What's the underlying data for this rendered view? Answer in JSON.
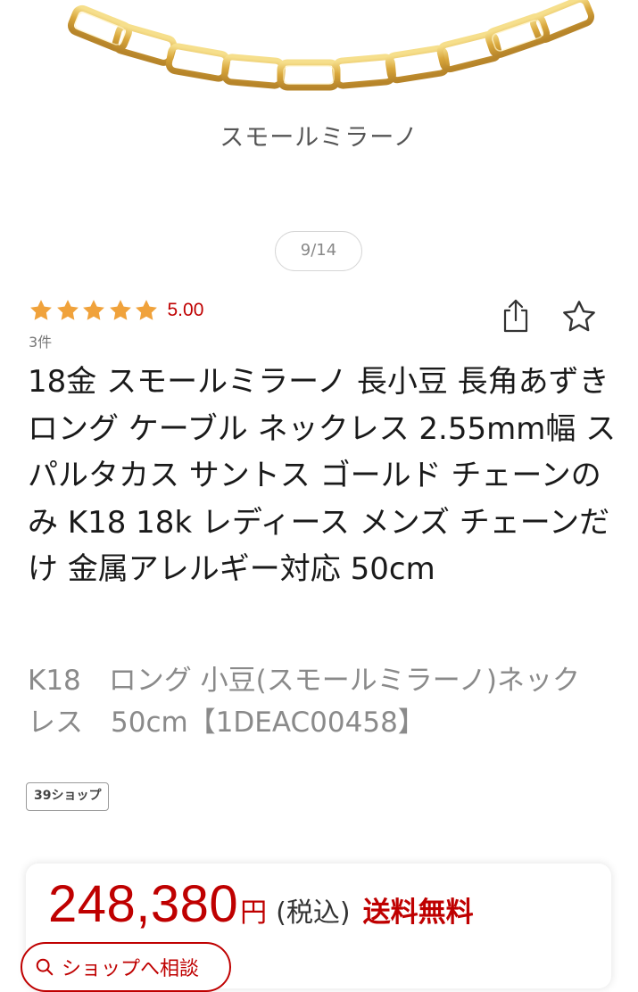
{
  "hero": {
    "caption": "スモールミラーノ",
    "pager": "9/14"
  },
  "rating": {
    "stars": 5,
    "value": "5.00",
    "review_count": "3件",
    "star_color": "#f0a23b"
  },
  "actions": {
    "share_icon": "share-icon",
    "favorite_icon": "star-outline-icon"
  },
  "product": {
    "title": "18金 スモールミラーノ 長小豆 長角あずき ロング ケーブル ネックレス 2.55mm幅 スパルタカス サントス ゴールド チェーンのみ K18 18k レディース メンズ チェーンだけ 金属アレルギー対応 50cm",
    "subtitle": "K18　ロング 小豆(スモールミラーノ)ネックレス　50cm【1DEAC00458】",
    "shop_badge": "39ショップ"
  },
  "price": {
    "amount": "248,380",
    "currency": "円",
    "tax_note": "(税込)",
    "shipping": "送料無料",
    "accent_color": "#bf0000"
  },
  "consult": {
    "label": "ショップへ相談"
  }
}
